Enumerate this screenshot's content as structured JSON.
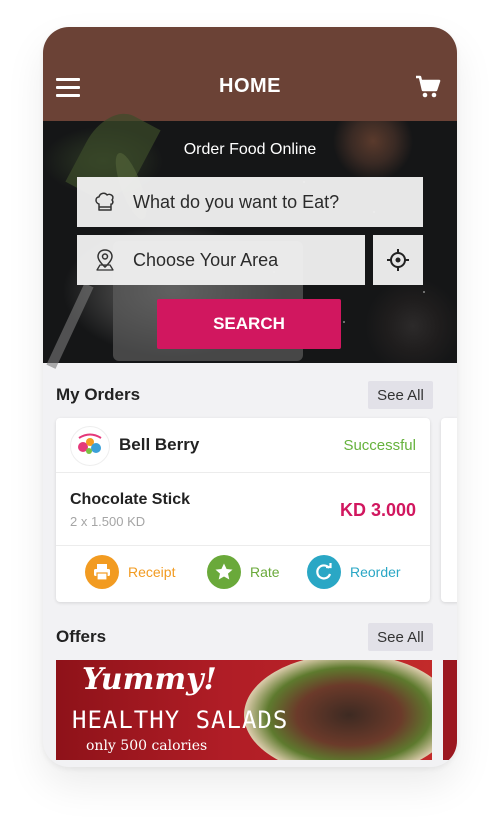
{
  "header": {
    "title": "HOME"
  },
  "hero": {
    "title": "Order Food Online",
    "food_placeholder": "What do you want to Eat?",
    "area_placeholder": "Choose Your Area",
    "search_label": "SEARCH"
  },
  "orders": {
    "title": "My Orders",
    "see_all": "See All",
    "card": {
      "restaurant": "Bell Berry",
      "status": "Successful",
      "item": "Chocolate Stick",
      "qty": "2 x 1.500 KD",
      "price": "KD 3.000",
      "actions": [
        {
          "label": "Receipt",
          "icon": "printer-icon",
          "color": "#f29b21"
        },
        {
          "label": "Rate",
          "icon": "star-icon",
          "color": "#6aa93a"
        },
        {
          "label": "Reorder",
          "icon": "refresh-icon",
          "color": "#2aa7c5"
        }
      ]
    }
  },
  "offers": {
    "title": "Offers",
    "see_all": "See All",
    "banner": {
      "headline": "Yummy!",
      "subtitle": "HEALTHY SALADS",
      "note": "only 500 calories"
    }
  },
  "colors": {
    "header": "#6b4236",
    "accent": "#d1175f",
    "success": "#66b23d"
  }
}
